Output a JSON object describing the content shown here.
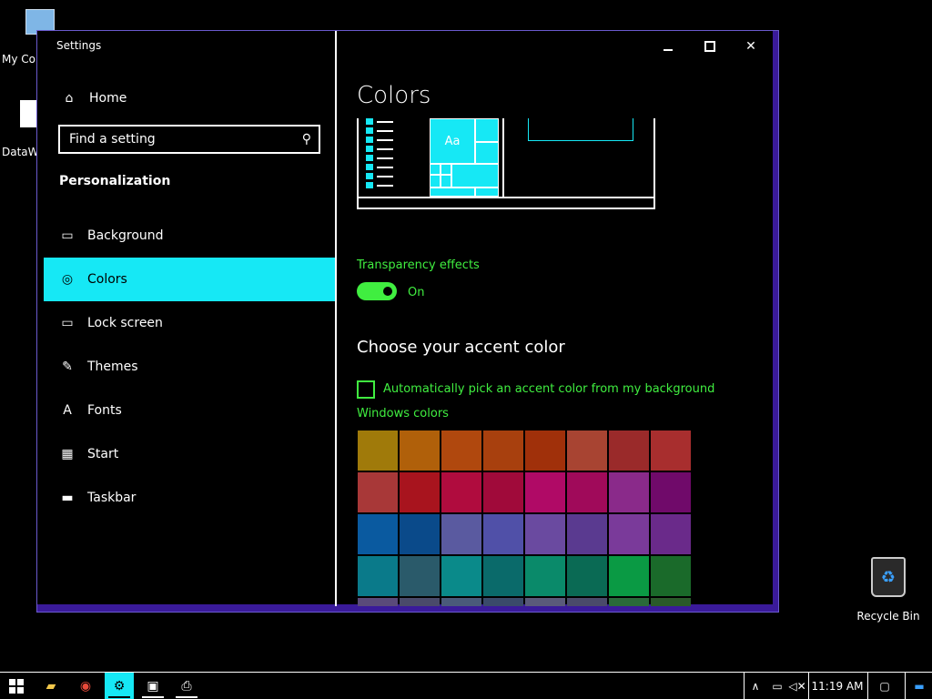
{
  "desktop": {
    "icons": [
      {
        "label": "My Cor"
      },
      {
        "label": "DataW"
      },
      {
        "label": "Recycle Bin"
      }
    ]
  },
  "window": {
    "title": "Settings",
    "controls": {
      "minimize": "—",
      "maximize": "□",
      "close": "✕"
    }
  },
  "nav": {
    "home": "Home",
    "search_placeholder": "Find a setting",
    "section": "Personalization",
    "items": [
      {
        "label": "Background",
        "icon": "picture-icon"
      },
      {
        "label": "Colors",
        "icon": "palette-icon",
        "selected": true
      },
      {
        "label": "Lock screen",
        "icon": "lock-screen-icon"
      },
      {
        "label": "Themes",
        "icon": "themes-icon"
      },
      {
        "label": "Fonts",
        "icon": "fonts-icon"
      },
      {
        "label": "Start",
        "icon": "start-icon"
      },
      {
        "label": "Taskbar",
        "icon": "taskbar-icon"
      }
    ]
  },
  "content": {
    "title": "Colors",
    "preview_tile_text": "Aa",
    "transparency_label": "Transparency effects",
    "transparency_state": "On",
    "accent_heading": "Choose your accent color",
    "auto_pick_label": "Automatically pick an accent color from my background",
    "windows_colors_label": "Windows colors",
    "swatches": [
      "#a07a0a",
      "#b0600a",
      "#b0480e",
      "#a8400e",
      "#a0300a",
      "#a84432",
      "#9a2a2a",
      "#a82e2e",
      "#a83838",
      "#a8141e",
      "#b00c3e",
      "#a00a3a",
      "#b00a66",
      "#a00a5a",
      "#8a2a8a",
      "#700a6a",
      "#0a5aa0",
      "#0a4a8a",
      "#5a5aa0",
      "#5050a8",
      "#6a4aa0",
      "#5a3a90",
      "#7a3a9a",
      "#6a2a8a",
      "#0a7a8a",
      "#2a5a6a",
      "#0a8a8a",
      "#0a6a6a",
      "#0a8a6a",
      "#0a6a54",
      "#0a9a44",
      "#1a6a2a",
      "#5a4a7a",
      "#4a4a6a",
      "#4a5a7a",
      "#3a4a6a",
      "#5a5a7a",
      "#4a4a6a",
      "#2a6a3a",
      "#2a5a2a"
    ],
    "accent": "#16e8f5",
    "text_green": "#40ee40"
  },
  "taskbar": {
    "clock": "11:19 AM",
    "apps": [
      {
        "icon": "file-explorer-icon"
      },
      {
        "icon": "chrome-icon"
      },
      {
        "icon": "settings-icon",
        "active": true
      },
      {
        "icon": "network-app-icon"
      },
      {
        "icon": "printer-icon"
      }
    ]
  }
}
